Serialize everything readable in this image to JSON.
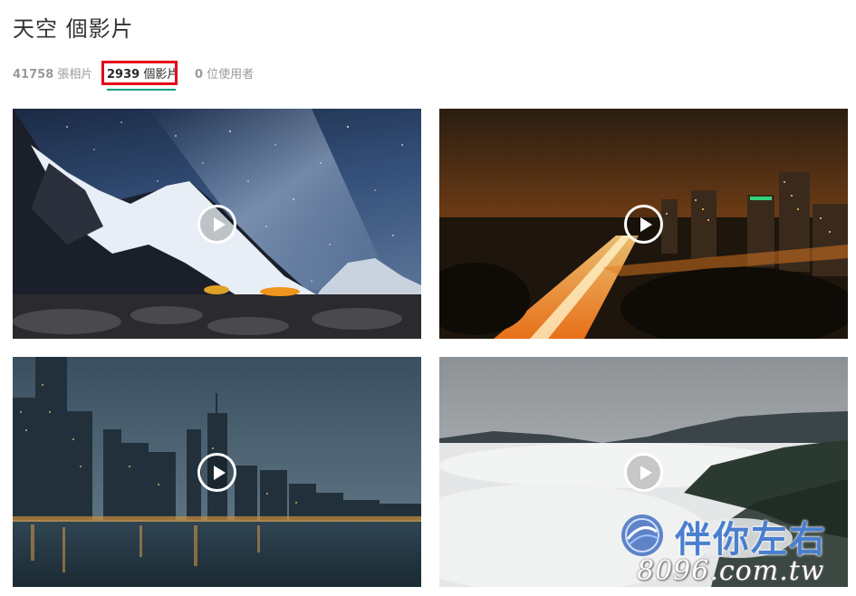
{
  "page": {
    "title": "天空 個影片"
  },
  "tabs": {
    "photos": {
      "count": "41758",
      "label": " 張相片"
    },
    "videos": {
      "count": "2939",
      "label": " 個影片",
      "selected": true
    },
    "users": {
      "count": "0",
      "label": " 位使用者"
    }
  },
  "videos": [
    {
      "scene": "milky-way-mountains"
    },
    {
      "scene": "night-city-highway"
    },
    {
      "scene": "city-skyline-dusk"
    },
    {
      "scene": "fog-over-forest"
    }
  ],
  "watermark": {
    "name": "伴你左右",
    "url": "8096.com.tw"
  },
  "colors": {
    "selected_underline": "#05a081",
    "highlight_box": "#e3001b",
    "watermark_blue": "#4a7fcf"
  }
}
